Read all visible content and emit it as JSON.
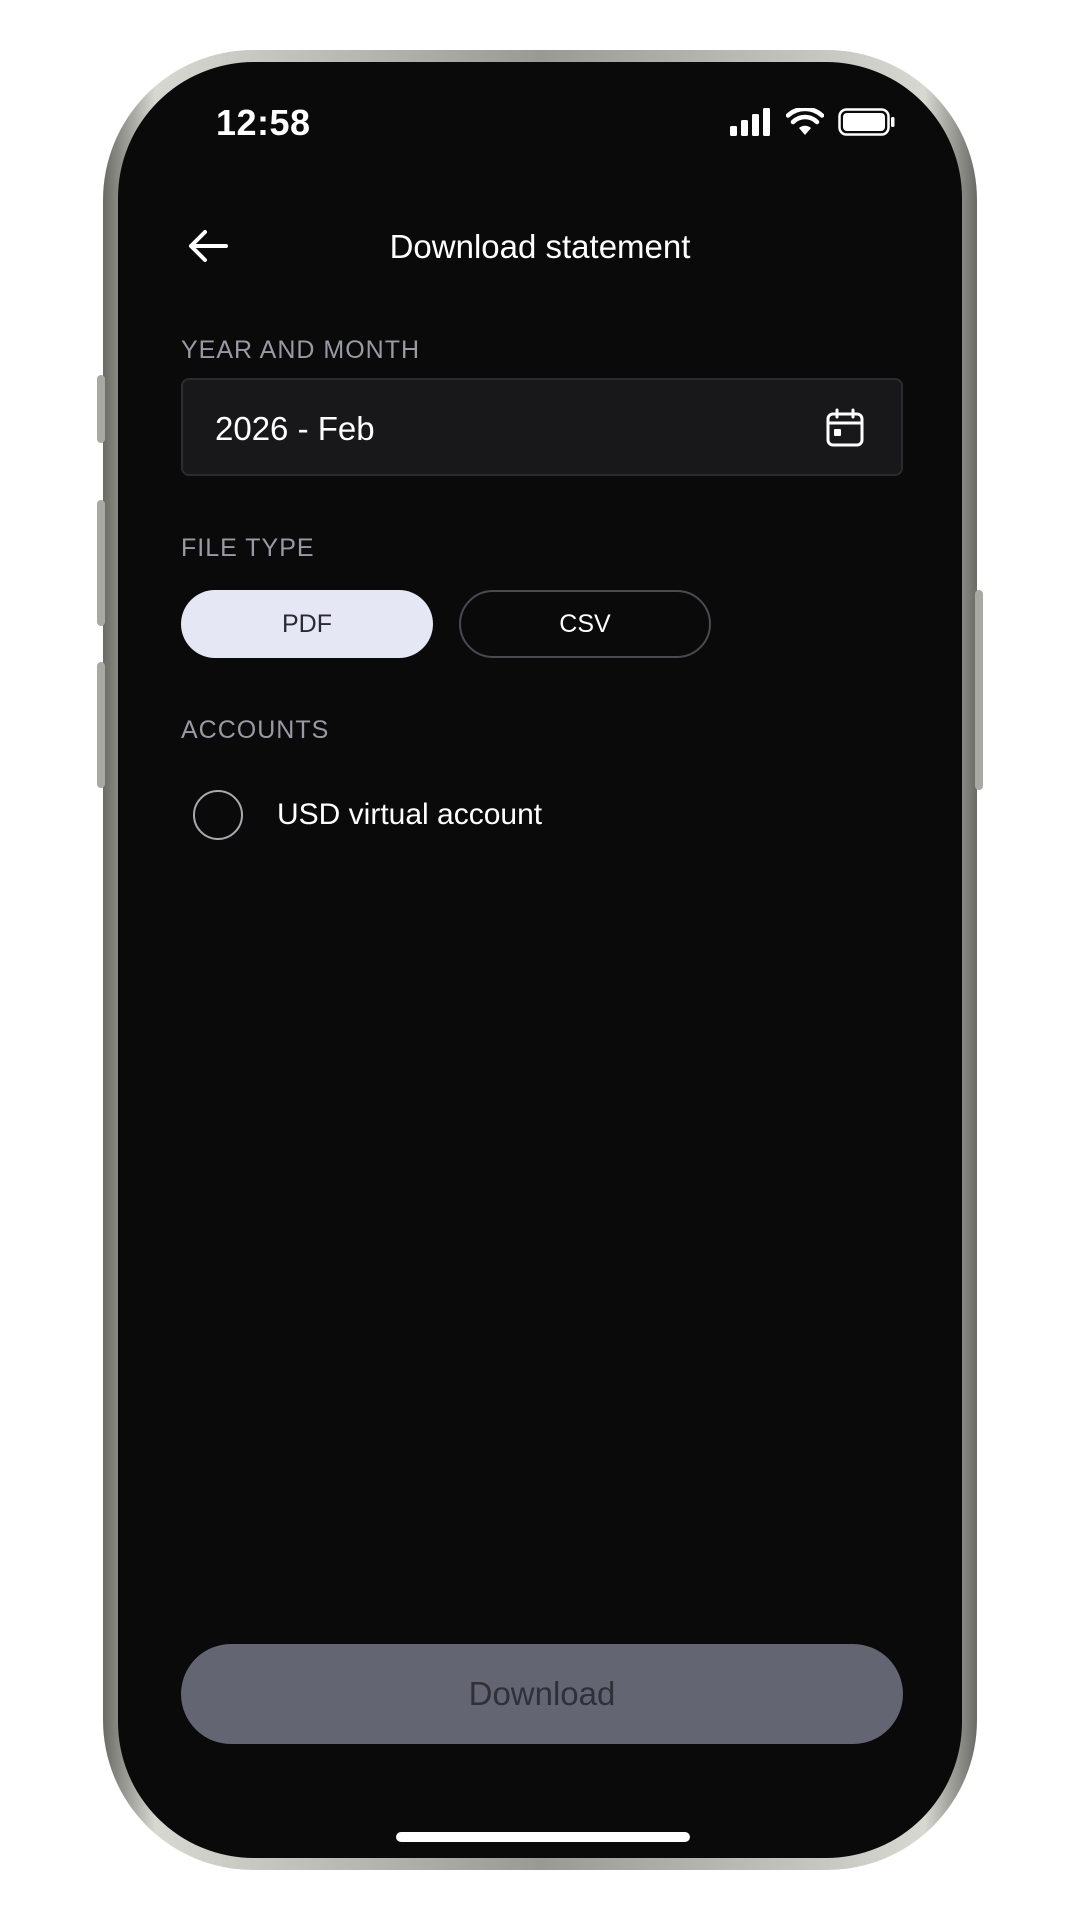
{
  "status_bar": {
    "time": "12:58",
    "icons": [
      "cellular-signal-icon",
      "wifi-icon",
      "battery-icon"
    ]
  },
  "header": {
    "title": "Download statement",
    "back_icon": "arrow-left-icon"
  },
  "period": {
    "label": "YEAR AND MONTH",
    "value": "2026 - Feb",
    "icon": "calendar-icon"
  },
  "file_type": {
    "label": "FILE TYPE",
    "options": [
      {
        "label": "PDF",
        "selected": true
      },
      {
        "label": "CSV",
        "selected": false
      }
    ]
  },
  "accounts": {
    "label": "ACCOUNTS",
    "items": [
      {
        "label": "USD virtual account",
        "selected": false
      }
    ]
  },
  "actions": {
    "download_label": "Download",
    "download_enabled": false
  },
  "colors": {
    "background": "#0a0a0b",
    "field_background": "#18181b",
    "chip_selected": "#e6e7f5",
    "button_disabled": "#636573",
    "label_muted": "#9a9aa4"
  }
}
